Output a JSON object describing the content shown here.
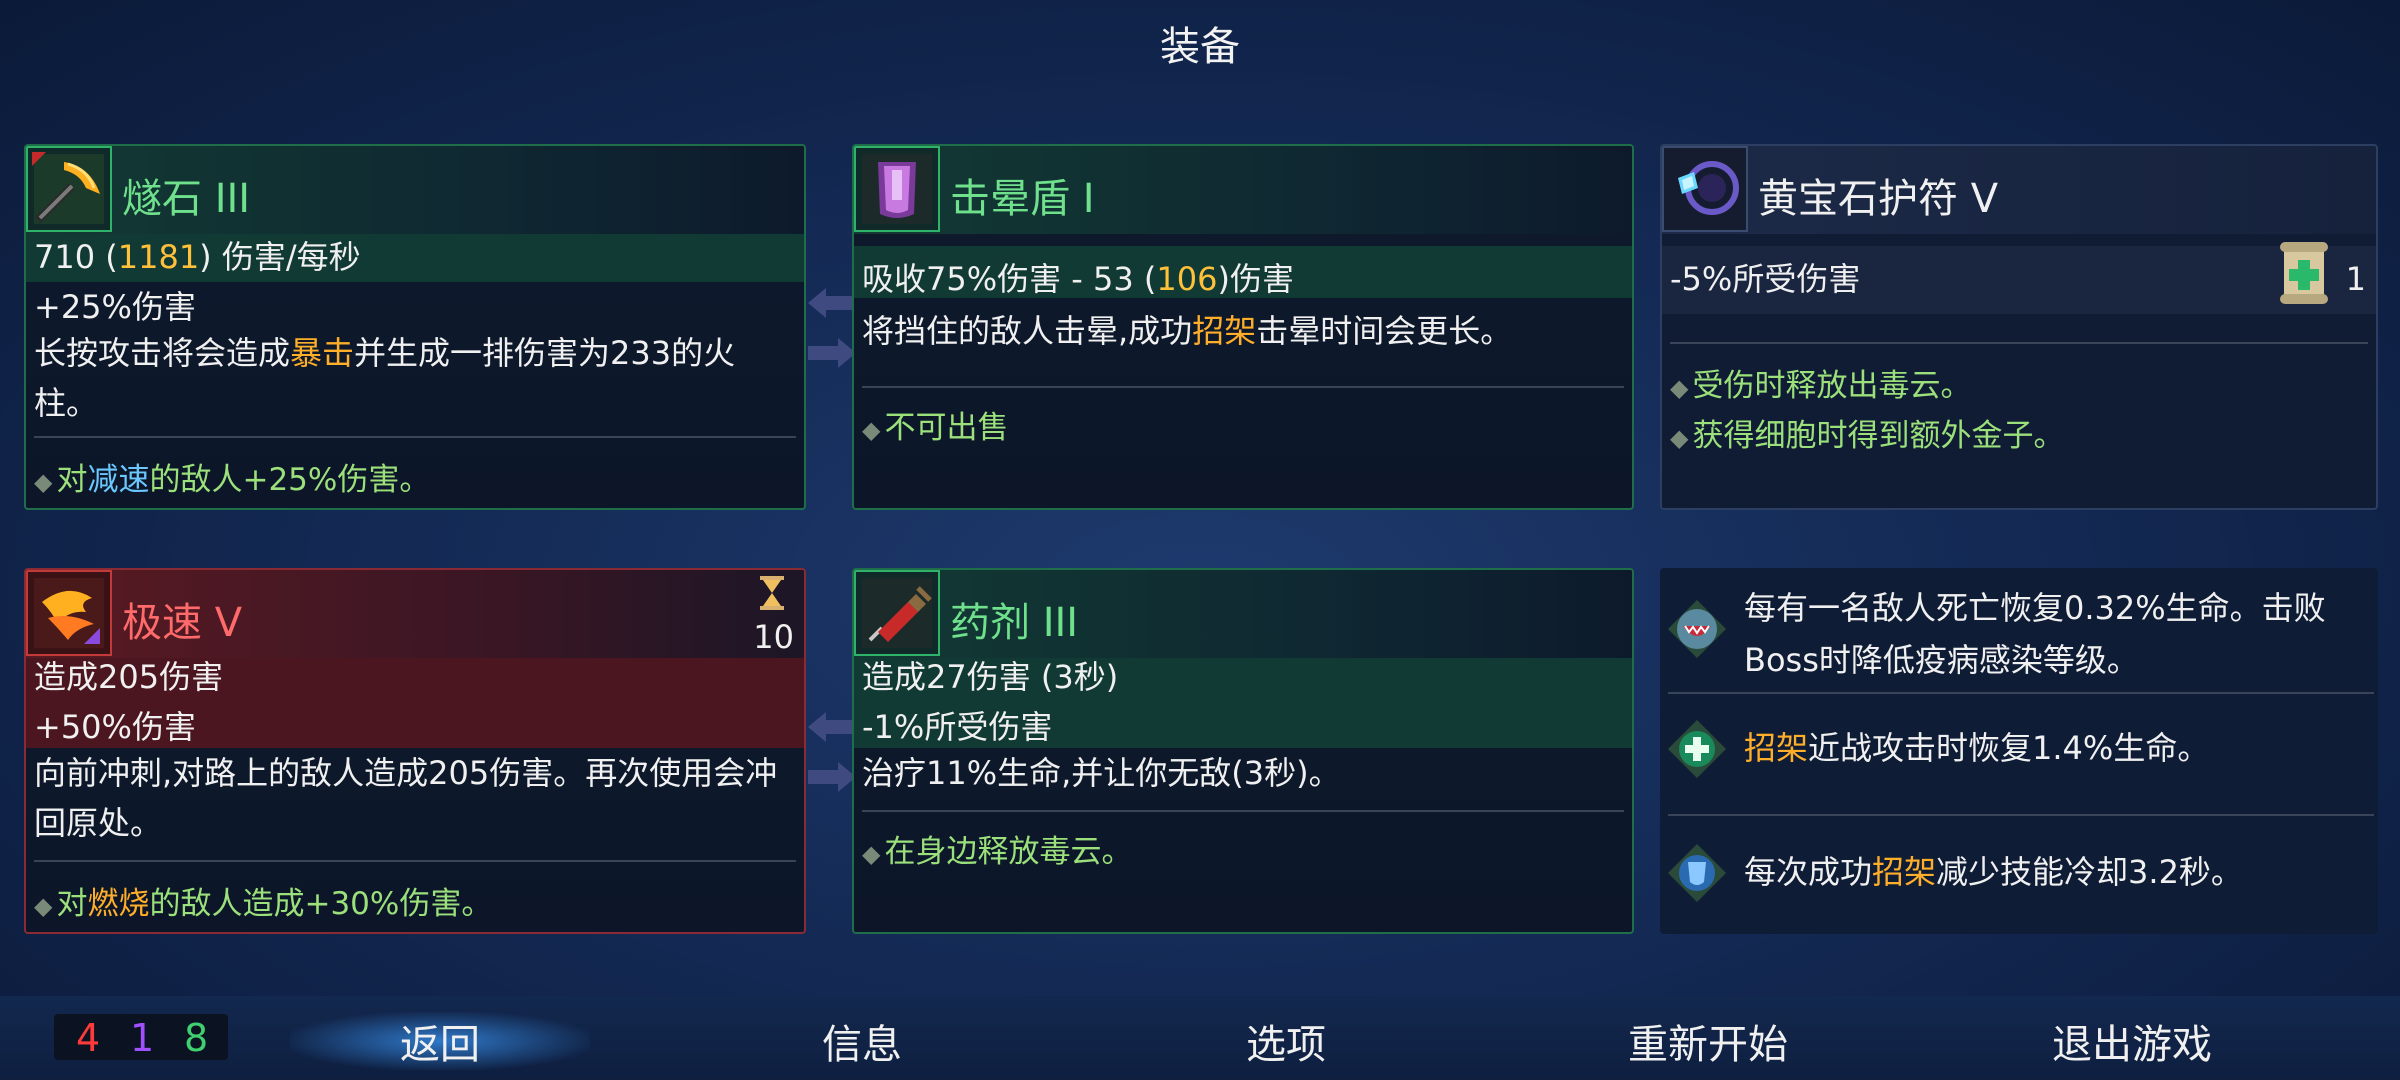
{
  "screen_title": "装备",
  "weapon1": {
    "icon": "flint-pickaxe-icon",
    "name": "燧石 III",
    "stat1_a": "710 (",
    "stat1_b": "1181",
    "stat1_c": ") 伤害/每秒",
    "stat2": "+25%伤害",
    "desc_a": "长按攻击将会造成",
    "desc_b": "暴击",
    "desc_c": "并生成一排伤害为233的火柱。",
    "affix_a": "对",
    "affix_b": "减速",
    "affix_c": "的敌人+25%伤害。"
  },
  "shield": {
    "icon": "stun-shield-icon",
    "name": "击晕盾 I",
    "stat1_a": "吸收75%伤害 - 53 (",
    "stat1_b": "106",
    "stat1_c": ")伤害",
    "desc_a": "将挡住的敌人击晕,成功",
    "desc_b": "招架",
    "desc_c": "击晕时间会更长。",
    "affix": "不可出售"
  },
  "amulet": {
    "icon": "topaz-amulet-icon",
    "name": "黄宝石护符 V",
    "stat1": "-5%所受伤害",
    "scroll_count": "1",
    "affix1_a": "受伤时释放出",
    "affix1_b": "毒云",
    "affix1_c": "。",
    "affix2": "获得细胞时得到额外金子。"
  },
  "skill1": {
    "icon": "speed-skill-icon",
    "name": "极速 V",
    "cooldown": "10",
    "stat1": "造成205伤害",
    "stat2": "+50%伤害",
    "desc": "向前冲刺,对路上的敌人造成205伤害。再次使用会冲回原处。",
    "affix_a": "对",
    "affix_b": "燃烧",
    "affix_c": "的敌人造成+30%伤害。"
  },
  "skill2": {
    "icon": "syringe-potion-icon",
    "name": "药剂 III",
    "stat1": "造成27伤害 (3秒)",
    "stat2": "-1%所受伤害",
    "desc": "治疗11%生命,并让你无敌(3秒)。",
    "affix_a": "在身边释放",
    "affix_b": "毒云",
    "affix_c": "。"
  },
  "mutations": [
    {
      "icon": "monster-mouth-icon",
      "text": "每有一名敌人死亡恢复0.32%生命。击败Boss时降低疫病感染等级。"
    },
    {
      "icon": "parry-heal-icon",
      "text_a": "招架",
      "text_b": "近战攻击时恢复1.4%生命。"
    },
    {
      "icon": "parry-cooldown-icon",
      "text_a": "每次成功",
      "text_b": "招架",
      "text_c": "减少技能冷却3.2秒。"
    }
  ],
  "scrolls": {
    "brutality": "4",
    "tactics": "1",
    "survival": "8"
  },
  "menu": {
    "back": "返回",
    "info": "信息",
    "options": "选项",
    "restart": "重新开始",
    "quit": "退出游戏"
  }
}
